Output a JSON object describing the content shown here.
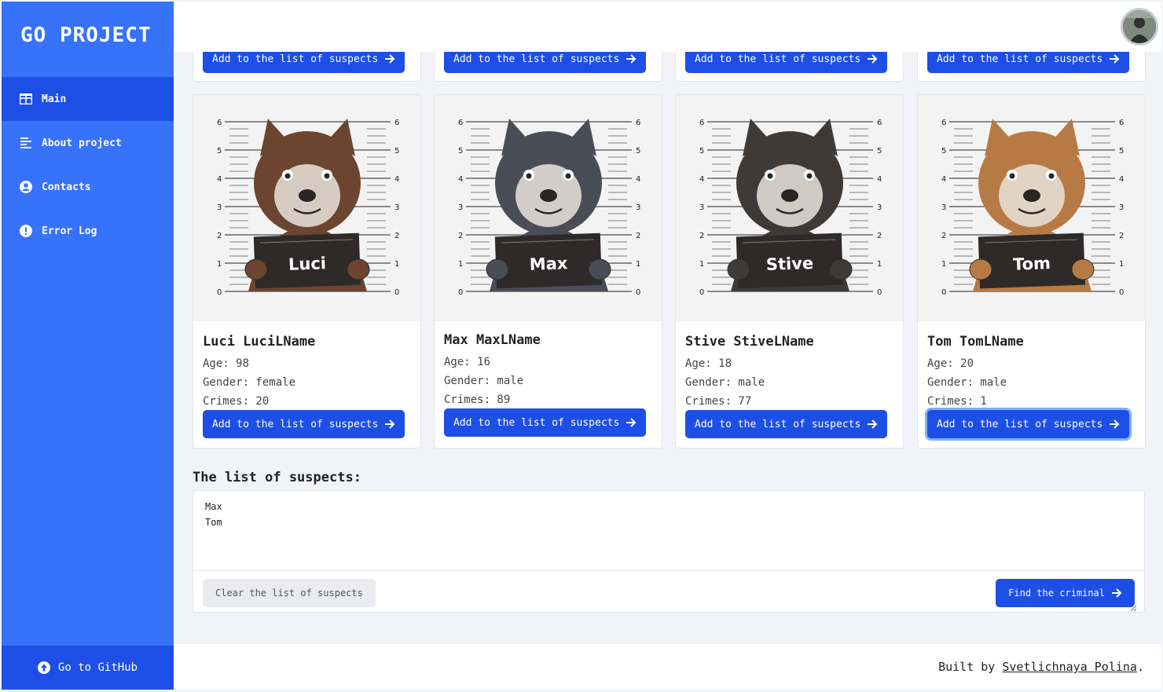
{
  "brand": "GO PROJECT",
  "nav": [
    {
      "label": "Main",
      "icon": "table-icon"
    },
    {
      "label": "About project",
      "icon": "align-left-icon"
    },
    {
      "label": "Contacts",
      "icon": "user-circle-icon"
    },
    {
      "label": "Error Log",
      "icon": "alert-circle-icon"
    }
  ],
  "github_label": "Go to GitHub",
  "add_label": "Add to the list of suspects",
  "suspects": [
    {
      "name": "Luci LuciLName",
      "plate": "Luci",
      "age_label": "Age: 98",
      "gender_label": "Gender: female",
      "crimes_label": "Crimes: 20",
      "color": "#6b4530"
    },
    {
      "name": "Max MaxLName",
      "plate": "Max",
      "age_label": "Age: 16",
      "gender_label": "Gender: male",
      "crimes_label": "Crimes: 89",
      "color": "#4a4d56"
    },
    {
      "name": "Stive StiveLName",
      "plate": "Stive",
      "age_label": "Age: 18",
      "gender_label": "Gender: male",
      "crimes_label": "Crimes: 77",
      "color": "#3e3a38"
    },
    {
      "name": "Tom TomLName",
      "plate": "Tom",
      "age_label": "Age: 20",
      "gender_label": "Gender: male",
      "crimes_label": "Crimes: 1",
      "color": "#b77a45"
    }
  ],
  "list_title": "The list of suspects:",
  "list_value": "Max\nTom",
  "clear_label": "Clear the list of suspects",
  "find_label": "Find the criminal",
  "footer_prefix": "Built by ",
  "footer_author": "Svetlichnaya Polina",
  "footer_suffix": "."
}
